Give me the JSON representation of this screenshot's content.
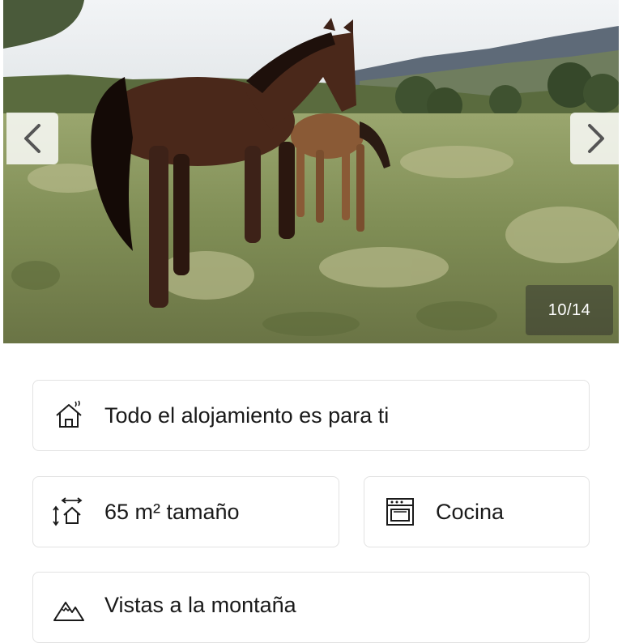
{
  "gallery": {
    "counter": "10/14",
    "prev_icon": "chevron-left-icon",
    "next_icon": "chevron-right-icon"
  },
  "amenities": {
    "entire_place": {
      "label": "Todo el alojamiento es para ti",
      "icon": "house-icon"
    },
    "size": {
      "label": "65 m² tamaño",
      "icon": "floor-area-icon"
    },
    "kitchen": {
      "label": "Cocina",
      "icon": "oven-icon"
    },
    "views": {
      "label": "Vistas a la montaña",
      "icon": "mountain-icon"
    }
  },
  "colors": {
    "text": "#1a1a1a",
    "card_border": "#e2e2e2",
    "counter_bg": "#282828"
  }
}
